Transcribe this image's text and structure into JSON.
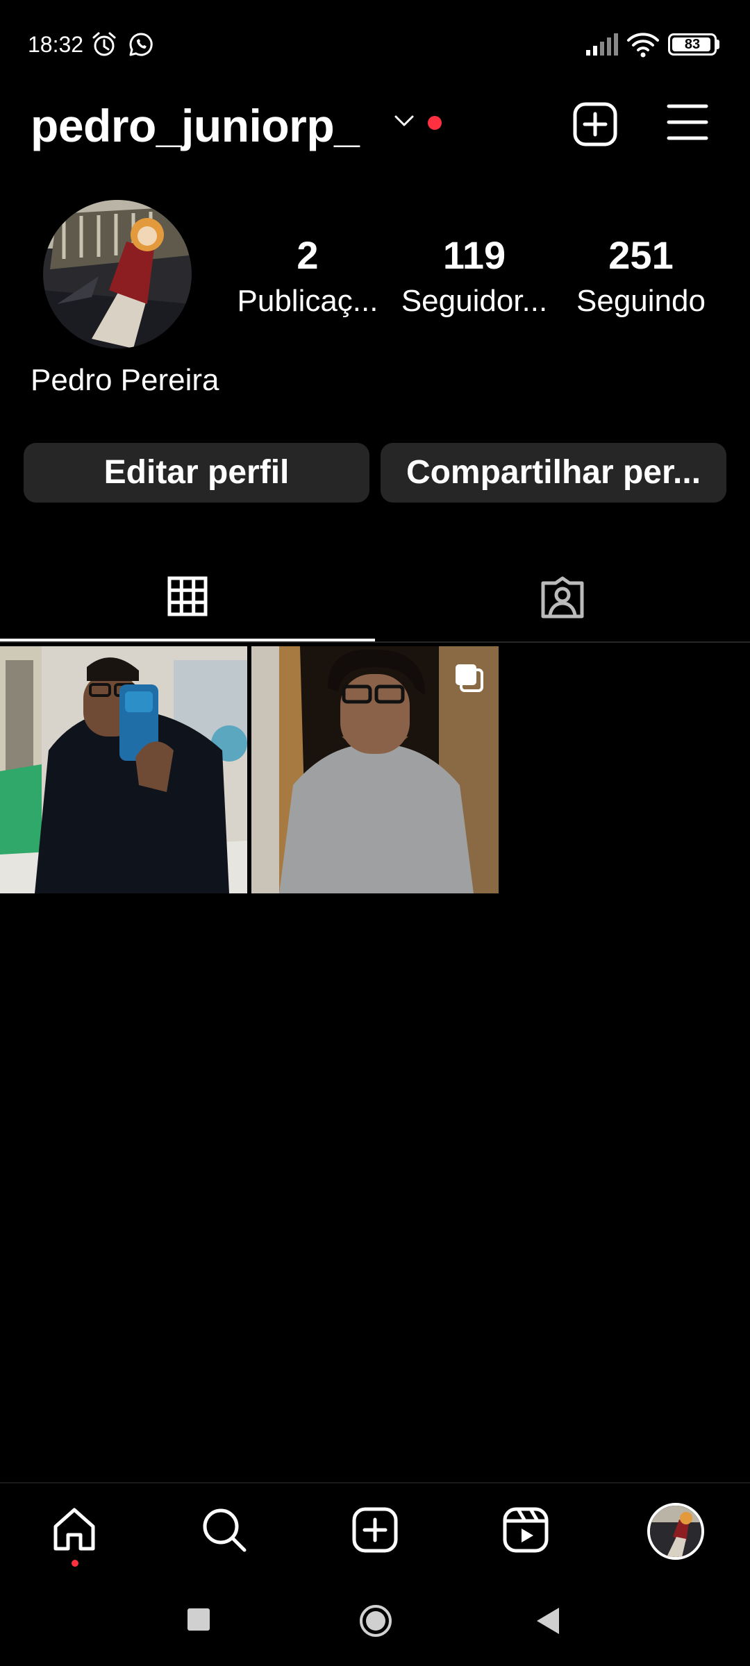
{
  "status_bar": {
    "time": "18:32",
    "battery_level": "83",
    "icons": [
      "alarm-icon",
      "whatsapp-icon",
      "signal-icon",
      "wifi-icon",
      "battery-icon"
    ]
  },
  "header": {
    "username": "pedro_juniorp_",
    "has_notification": true
  },
  "profile": {
    "display_name": "Pedro Pereira",
    "stats": [
      {
        "value": "2",
        "label": "Publicaç..."
      },
      {
        "value": "119",
        "label": "Seguidor..."
      },
      {
        "value": "251",
        "label": "Seguindo"
      }
    ]
  },
  "actions": {
    "edit_label": "Editar perfil",
    "share_label": "Compartilhar per..."
  },
  "tabs": [
    {
      "name": "grid",
      "icon": "grid-icon",
      "active": true
    },
    {
      "name": "tagged",
      "icon": "tagged-person-icon",
      "active": false
    }
  ],
  "posts": [
    {
      "description": "mirror selfie, dark shirt",
      "multiple": false
    },
    {
      "description": "portrait, grey t-shirt",
      "multiple": true
    }
  ],
  "bottom_nav": [
    {
      "name": "home",
      "icon": "home-icon",
      "active": true
    },
    {
      "name": "search",
      "icon": "search-icon"
    },
    {
      "name": "create",
      "icon": "plus-square-icon"
    },
    {
      "name": "reels",
      "icon": "reels-icon"
    },
    {
      "name": "profile",
      "icon": "avatar"
    }
  ],
  "colors": {
    "background": "#000000",
    "button_bg": "#262626",
    "notification_red": "#ff3040",
    "text": "#ffffff"
  }
}
